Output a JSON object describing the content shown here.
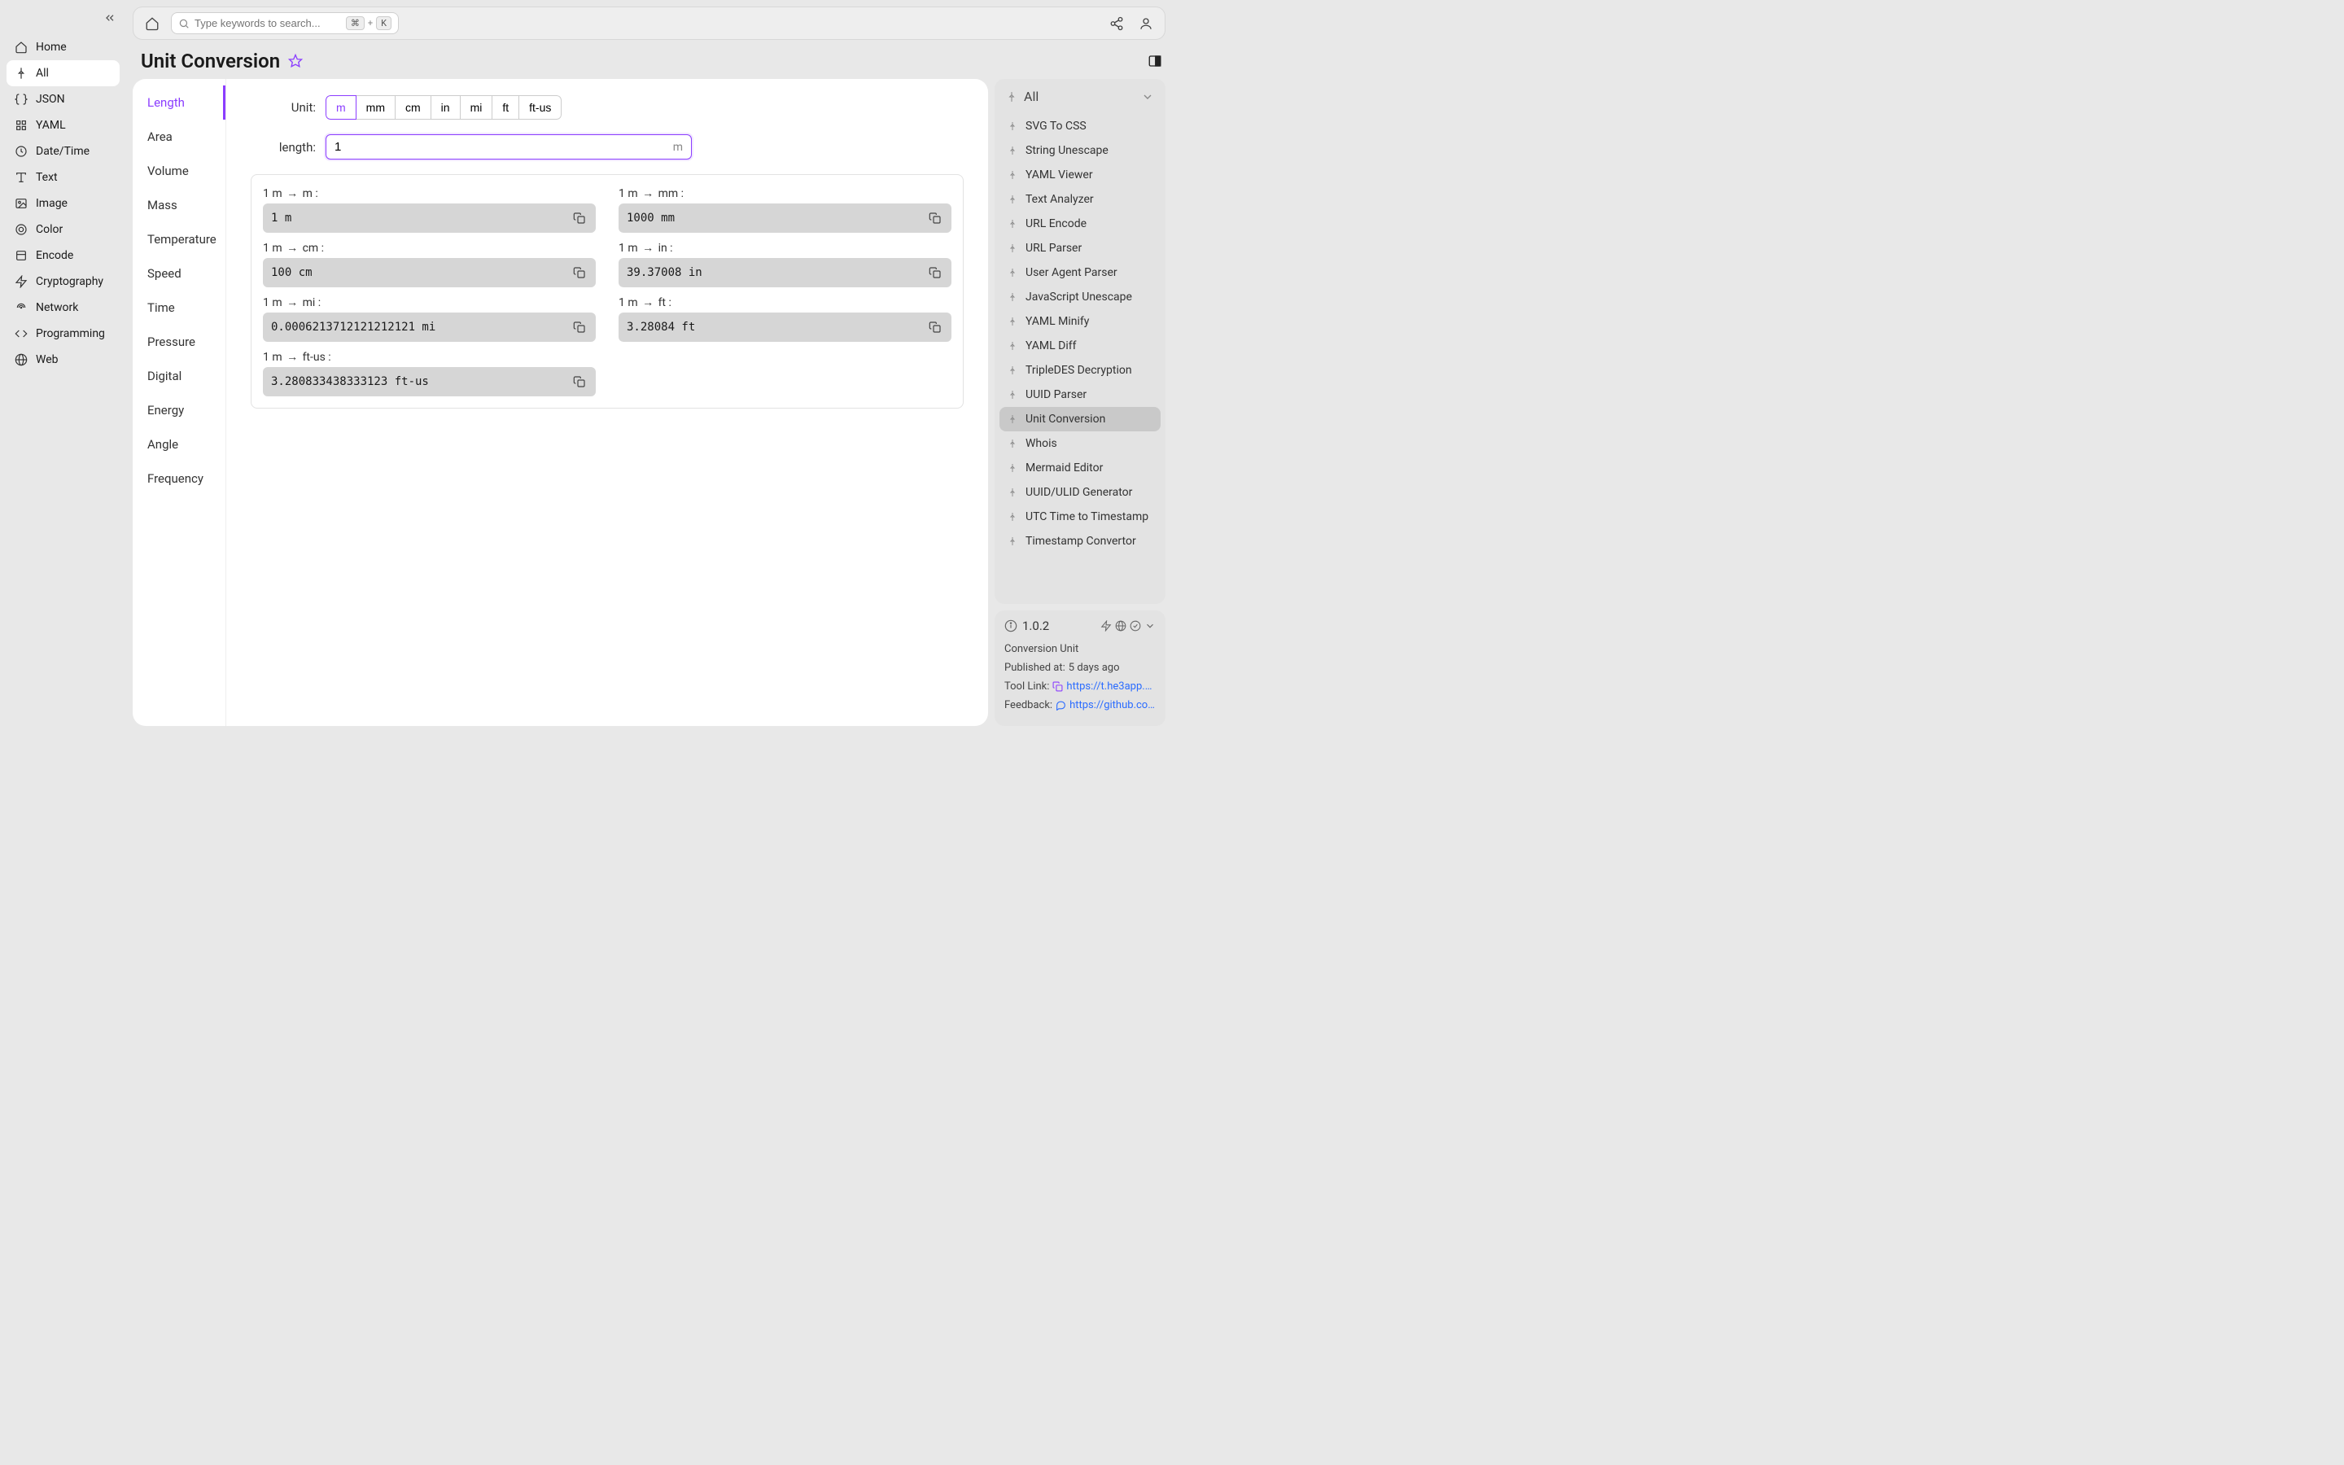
{
  "sidebar": {
    "items": [
      {
        "label": "Home"
      },
      {
        "label": "All",
        "active": true
      },
      {
        "label": "JSON"
      },
      {
        "label": "YAML"
      },
      {
        "label": "Date/Time"
      },
      {
        "label": "Text"
      },
      {
        "label": "Image"
      },
      {
        "label": "Color"
      },
      {
        "label": "Encode"
      },
      {
        "label": "Cryptography"
      },
      {
        "label": "Network"
      },
      {
        "label": "Programming"
      },
      {
        "label": "Web"
      }
    ]
  },
  "topbar": {
    "search_placeholder": "Type keywords to search...",
    "kbd1": "⌘",
    "kbd_plus": "+",
    "kbd2": "K"
  },
  "page": {
    "title": "Unit Conversion"
  },
  "categories": [
    "Length",
    "Area",
    "Volume",
    "Mass",
    "Temperature",
    "Speed",
    "Time",
    "Pressure",
    "Digital",
    "Energy",
    "Angle",
    "Frequency"
  ],
  "active_category": "Length",
  "tool": {
    "unit_label": "Unit:",
    "units": [
      "m",
      "mm",
      "cm",
      "in",
      "mi",
      "ft",
      "ft-us"
    ],
    "selected_unit": "m",
    "length_label": "length:",
    "length_value": "1",
    "length_suffix": "m",
    "results": [
      {
        "label_from": "1 m",
        "label_to": "m",
        "value": "1 m"
      },
      {
        "label_from": "1 m",
        "label_to": "mm",
        "value": "1000 mm"
      },
      {
        "label_from": "1 m",
        "label_to": "cm",
        "value": "100 cm"
      },
      {
        "label_from": "1 m",
        "label_to": "in",
        "value": "39.37008 in"
      },
      {
        "label_from": "1 m",
        "label_to": "mi",
        "value": "0.0006213712121212121 mi"
      },
      {
        "label_from": "1 m",
        "label_to": "ft",
        "value": "3.28084 ft"
      },
      {
        "label_from": "1 m",
        "label_to": "ft-us",
        "value": "3.280833438333123 ft-us"
      }
    ]
  },
  "right": {
    "header": "All",
    "tools": [
      "SVG To CSS",
      "String Unescape",
      "YAML Viewer",
      "Text Analyzer",
      "URL Encode",
      "URL Parser",
      "User Agent Parser",
      "JavaScript Unescape",
      "YAML Minify",
      "YAML Diff",
      "TripleDES Decryption",
      "UUID Parser",
      "Unit Conversion",
      "Whois",
      "Mermaid Editor",
      "UUID/ULID Generator",
      "UTC Time to Timestamp",
      "Timestamp Convertor"
    ],
    "selected_tool": "Unit Conversion"
  },
  "info": {
    "version": "1.0.2",
    "name": "Conversion Unit",
    "published_label": "Published at:",
    "published_value": "5 days ago",
    "tool_link_label": "Tool Link:",
    "tool_link": "https://t.he3app.co…",
    "feedback_label": "Feedback:",
    "feedback_link": "https://github.com/…"
  }
}
